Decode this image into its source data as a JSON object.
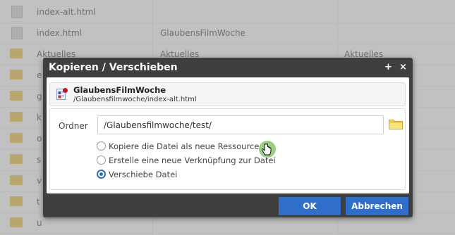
{
  "file_list": {
    "rows": [
      {
        "icon": "html-file-icon",
        "name": "index-alt.html",
        "col2": "",
        "col3": ""
      },
      {
        "icon": "html-file-icon",
        "name": "index.html",
        "col2": "GlaubensFilmWoche",
        "col3": ""
      },
      {
        "icon": "folder-icon",
        "name": "Aktuelles",
        "col2": "Aktuelles",
        "col3": "Aktuelles"
      },
      {
        "icon": "folder-icon",
        "name": "e",
        "col2": "",
        "col3": ""
      },
      {
        "icon": "folder-icon",
        "name": "g",
        "col2": "",
        "col3": ""
      },
      {
        "icon": "folder-icon",
        "name": "k",
        "col2": "",
        "col3": ""
      },
      {
        "icon": "folder-icon",
        "name": "o",
        "col2": "",
        "col3": ""
      },
      {
        "icon": "folder-icon",
        "name": "s",
        "col2": "",
        "col3": ""
      },
      {
        "icon": "folder-icon",
        "name": "v",
        "col2": "",
        "col3": ""
      },
      {
        "icon": "folder-icon",
        "name": "t",
        "col2": "",
        "col3": ""
      },
      {
        "icon": "folder-icon",
        "name": "u",
        "col2": "",
        "col3": ""
      }
    ]
  },
  "dialog": {
    "title": "Kopieren / Verschieben",
    "plus_label": "+",
    "close_label": "×",
    "resource": {
      "title": "GlaubensFilmWoche",
      "path": "/Glaubensfilmwoche/index-alt.html"
    },
    "ordner_label": "Ordner",
    "ordner_value": "/Glaubensfilmwoche/test/",
    "options": [
      {
        "label": "Kopiere die Datei als neue Ressource",
        "selected": false
      },
      {
        "label": "Erstelle eine neue Verknüpfung zur Datei",
        "selected": false
      },
      {
        "label": "Verschiebe Datei",
        "selected": true
      }
    ],
    "ok_label": "OK",
    "cancel_label": "Abbrechen"
  },
  "colors": {
    "dialog_bg": "#3f3f3f",
    "button_blue": "#2f6fc9",
    "radio_selected": "#2f6fb5",
    "folder_yellow": "#e9c86a"
  }
}
